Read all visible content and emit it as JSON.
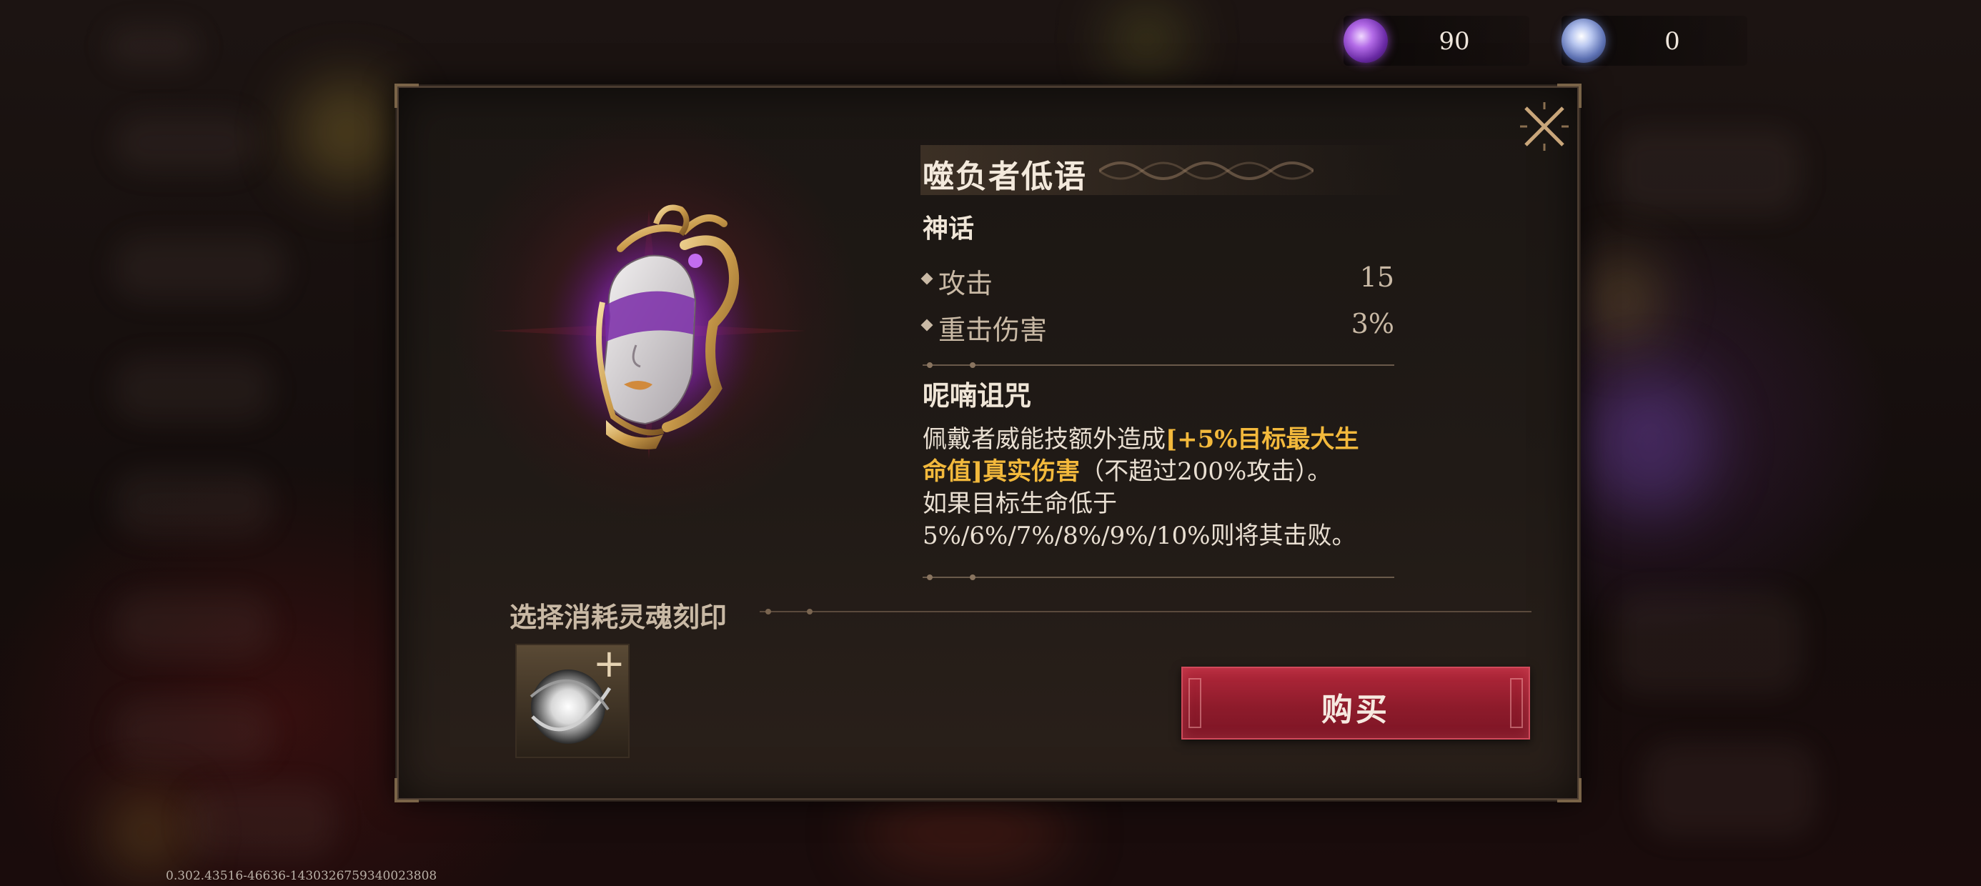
{
  "currencies": [
    {
      "icon": "purple-soul-orb-icon",
      "amount": "90",
      "color": "#9b4fd1"
    },
    {
      "icon": "blue-soul-orb-icon",
      "amount": "0",
      "color": "#6f86c8"
    }
  ],
  "item": {
    "name": "噬负者低语",
    "rarity": "神话",
    "art_icon": "ornate-mask-icon",
    "stats": [
      {
        "label": "攻击",
        "value": "15"
      },
      {
        "label": "重击伤害",
        "value": "3%"
      }
    ],
    "skill": {
      "name": "呢喃诅咒",
      "desc_part1": "佩戴者威能技额外造成",
      "desc_highlight": "[+5%目标最大生命值]真实伤害",
      "desc_part2": "（不超过200%攻击）。",
      "desc_line2": "如果目标生命低于5%/6%/7%/8%/9%/10%则将其击败。"
    }
  },
  "imprint": {
    "label": "选择消耗灵魂刻印",
    "slot_icon": "soul-imprint-orb-icon",
    "add_icon": "plus-icon"
  },
  "actions": {
    "buy_label": "购买"
  },
  "build_id": "0.302.43516-46636-1430326759340023808",
  "colors": {
    "highlight": "#f3b93c",
    "buy_button": "#a5223a",
    "dialog_bg": "#1e1815"
  }
}
